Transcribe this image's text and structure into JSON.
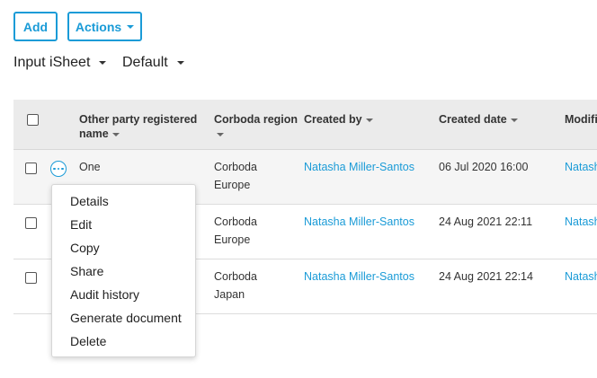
{
  "toolbar": {
    "add_label": "Add",
    "actions_label": "Actions"
  },
  "selectors": {
    "sheet": "Input iSheet",
    "view": "Default"
  },
  "table": {
    "headers": {
      "party_line1": "Other party registered",
      "party_line2": "name",
      "region_line1": "Corboda region",
      "created_by": "Created by",
      "created_date": "Created date",
      "modified": "Modifi"
    },
    "rows": [
      {
        "name": "One",
        "region_line1": "Corboda",
        "region_line2": "Europe",
        "created_by": "Natasha Miller-Santos",
        "created_date": "06 Jul 2020 16:00",
        "modified_by": "Natash"
      },
      {
        "name": "",
        "region_line1": "Corboda",
        "region_line2": "Europe",
        "created_by": "Natasha Miller-Santos",
        "created_date": "24 Aug 2021 22:11",
        "modified_by": "Natash"
      },
      {
        "name": "",
        "region_line1": "Corboda",
        "region_line2": "Japan",
        "created_by": "Natasha Miller-Santos",
        "created_date": "24 Aug 2021 22:14",
        "modified_by": "Natash"
      }
    ]
  },
  "context_menu": {
    "items": [
      "Details",
      "Edit",
      "Copy",
      "Share",
      "Audit history",
      "Generate document",
      "Delete"
    ]
  },
  "colors": {
    "accent": "#1a9bd7",
    "header_bg": "#ebebeb"
  }
}
